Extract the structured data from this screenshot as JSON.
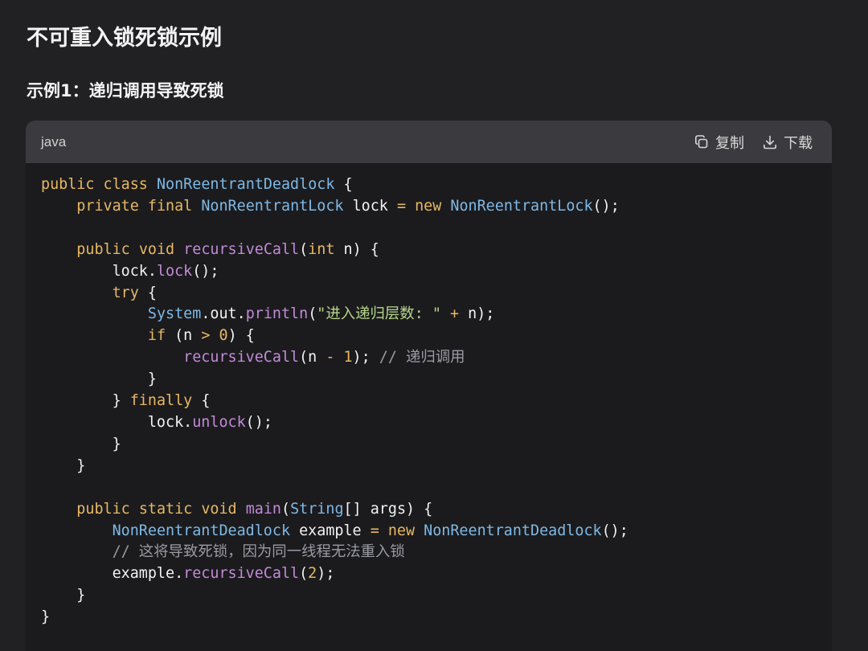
{
  "page": {
    "title": "不可重入锁死锁示例",
    "section_title": "示例1：递归调用导致死锁"
  },
  "code_block": {
    "language": "java",
    "copy_label": "复制",
    "download_label": "下载",
    "lines": [
      [
        [
          "kw",
          "public"
        ],
        [
          "pl",
          " "
        ],
        [
          "kw",
          "class"
        ],
        [
          "pl",
          " "
        ],
        [
          "ty",
          "NonReentrantDeadlock"
        ],
        [
          "pl",
          " {"
        ]
      ],
      [
        [
          "pl",
          "    "
        ],
        [
          "kw",
          "private"
        ],
        [
          "pl",
          " "
        ],
        [
          "kw",
          "final"
        ],
        [
          "pl",
          " "
        ],
        [
          "ty",
          "NonReentrantLock"
        ],
        [
          "pl",
          " lock "
        ],
        [
          "op",
          "="
        ],
        [
          "pl",
          " "
        ],
        [
          "kw",
          "new"
        ],
        [
          "pl",
          " "
        ],
        [
          "ty",
          "NonReentrantLock"
        ],
        [
          "pl",
          "();"
        ]
      ],
      [],
      [
        [
          "pl",
          "    "
        ],
        [
          "kw",
          "public"
        ],
        [
          "pl",
          " "
        ],
        [
          "kw",
          "void"
        ],
        [
          "pl",
          " "
        ],
        [
          "fn",
          "recursiveCall"
        ],
        [
          "pl",
          "("
        ],
        [
          "kw",
          "int"
        ],
        [
          "pl",
          " n) {"
        ]
      ],
      [
        [
          "pl",
          "        lock."
        ],
        [
          "fn",
          "lock"
        ],
        [
          "pl",
          "();"
        ]
      ],
      [
        [
          "pl",
          "        "
        ],
        [
          "kw",
          "try"
        ],
        [
          "pl",
          " {"
        ]
      ],
      [
        [
          "pl",
          "            "
        ],
        [
          "ty",
          "System"
        ],
        [
          "pl",
          ".out."
        ],
        [
          "fn",
          "println"
        ],
        [
          "pl",
          "("
        ],
        [
          "st",
          "\"进入递归层数: \""
        ],
        [
          "pl",
          " "
        ],
        [
          "op",
          "+"
        ],
        [
          "pl",
          " n);"
        ]
      ],
      [
        [
          "pl",
          "            "
        ],
        [
          "kw",
          "if"
        ],
        [
          "pl",
          " (n "
        ],
        [
          "op",
          ">"
        ],
        [
          "pl",
          " "
        ],
        [
          "nu",
          "0"
        ],
        [
          "pl",
          ") {"
        ]
      ],
      [
        [
          "pl",
          "                "
        ],
        [
          "fn",
          "recursiveCall"
        ],
        [
          "pl",
          "(n "
        ],
        [
          "op",
          "-"
        ],
        [
          "pl",
          " "
        ],
        [
          "nu",
          "1"
        ],
        [
          "pl",
          "); "
        ],
        [
          "cm",
          "// 递归调用"
        ]
      ],
      [
        [
          "pl",
          "            }"
        ]
      ],
      [
        [
          "pl",
          "        } "
        ],
        [
          "kw",
          "finally"
        ],
        [
          "pl",
          " {"
        ]
      ],
      [
        [
          "pl",
          "            lock."
        ],
        [
          "fn",
          "unlock"
        ],
        [
          "pl",
          "();"
        ]
      ],
      [
        [
          "pl",
          "        }"
        ]
      ],
      [
        [
          "pl",
          "    }"
        ]
      ],
      [],
      [
        [
          "pl",
          "    "
        ],
        [
          "kw",
          "public"
        ],
        [
          "pl",
          " "
        ],
        [
          "kw",
          "static"
        ],
        [
          "pl",
          " "
        ],
        [
          "kw",
          "void"
        ],
        [
          "pl",
          " "
        ],
        [
          "fn",
          "main"
        ],
        [
          "pl",
          "("
        ],
        [
          "ty",
          "String"
        ],
        [
          "pl",
          "[] args) {"
        ]
      ],
      [
        [
          "pl",
          "        "
        ],
        [
          "ty",
          "NonReentrantDeadlock"
        ],
        [
          "pl",
          " example "
        ],
        [
          "op",
          "="
        ],
        [
          "pl",
          " "
        ],
        [
          "kw",
          "new"
        ],
        [
          "pl",
          " "
        ],
        [
          "ty",
          "NonReentrantDeadlock"
        ],
        [
          "pl",
          "();"
        ]
      ],
      [
        [
          "pl",
          "        "
        ],
        [
          "cm",
          "// 这将导致死锁，因为同一线程无法重入锁"
        ]
      ],
      [
        [
          "pl",
          "        example."
        ],
        [
          "fn",
          "recursiveCall"
        ],
        [
          "pl",
          "("
        ],
        [
          "nu",
          "2"
        ],
        [
          "pl",
          ");"
        ]
      ],
      [
        [
          "pl",
          "    }"
        ]
      ],
      [
        [
          "pl",
          "}"
        ]
      ]
    ]
  }
}
